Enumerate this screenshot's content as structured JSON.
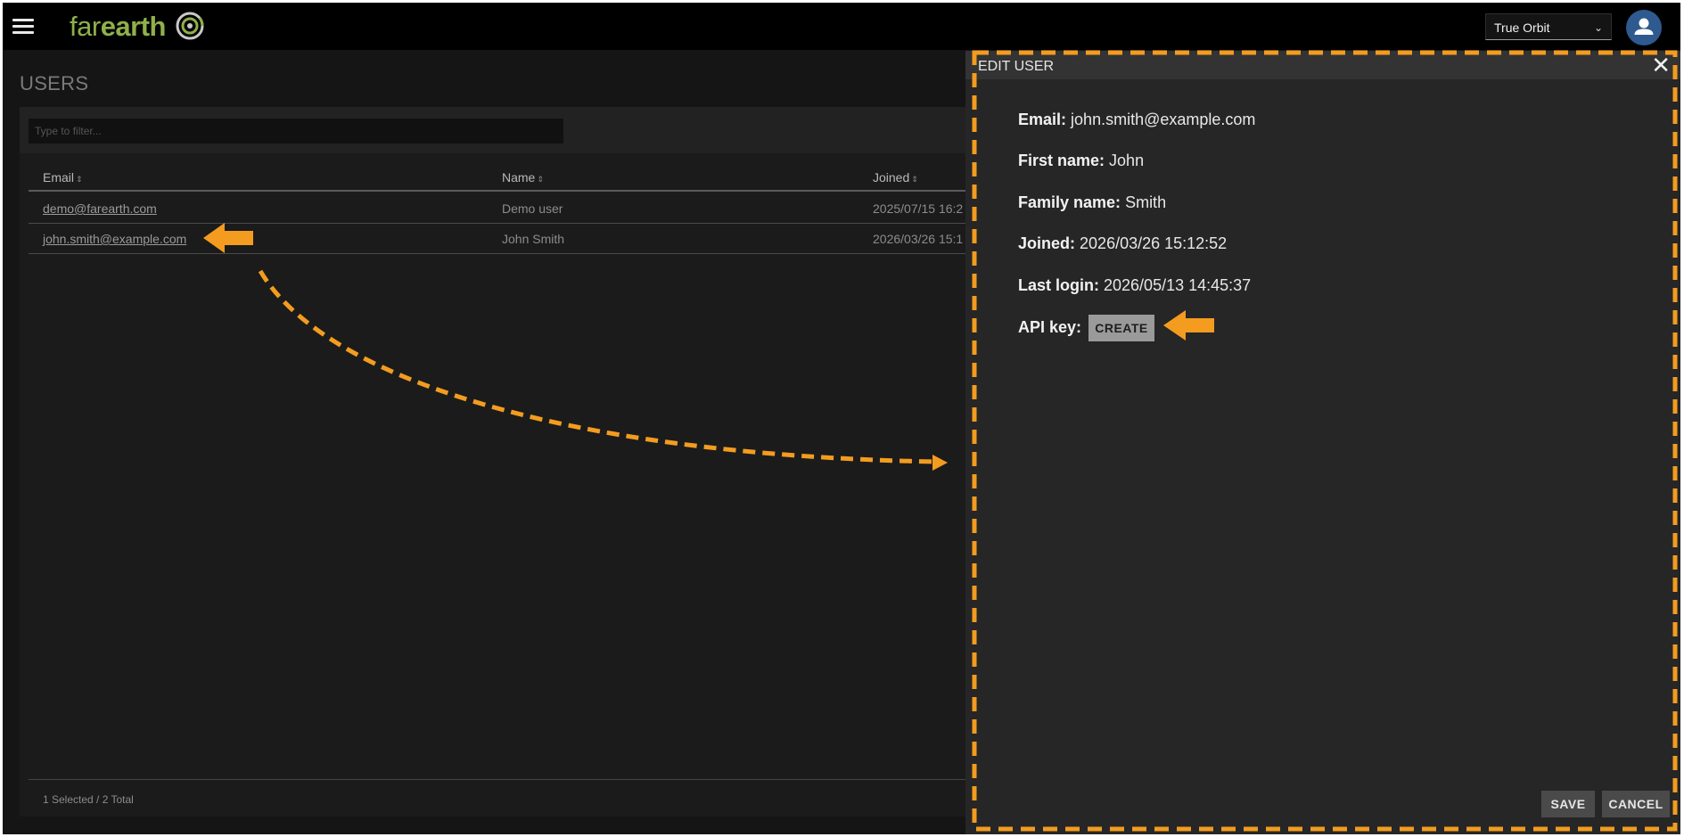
{
  "app": {
    "logo_far": "far",
    "logo_earth": "earth",
    "org_selected": "True Orbit"
  },
  "users_page": {
    "title": "USERS",
    "filter_placeholder": "Type to filter...",
    "columns": [
      "Email",
      "Name",
      "Joined"
    ],
    "rows": [
      {
        "email": "demo@farearth.com",
        "name": "Demo user",
        "joined": "2025/07/15 16:2"
      },
      {
        "email": "john.smith@example.com",
        "name": "John Smith",
        "joined": "2026/03/26 15:1"
      }
    ],
    "footer": "1 Selected / 2 Total"
  },
  "dialog": {
    "title": "EDIT USER",
    "close_glyph": "✕",
    "email_label": "Email:",
    "email_value": "john.smith@example.com",
    "first_name_label": "First name:",
    "first_name_value": "John",
    "family_name_label": "Family name:",
    "family_name_value": "Smith",
    "joined_label": "Joined:",
    "joined_value": "2026/03/26 15:12:52",
    "last_login_label": "Last login:",
    "last_login_value": "2026/05/13 14:45:37",
    "api_key_label": "API key:",
    "create_label": "CREATE",
    "save_label": "SAVE",
    "cancel_label": "CANCEL"
  },
  "icons": {
    "menu": "hamburger-icon",
    "logo_mark": "orbit-swirl-icon",
    "close": "close-icon",
    "avatar": "user-icon",
    "sort": "sort-icon",
    "dropdown": "chevron-down-icon",
    "annotation_arrow": "arrow-left-icon"
  },
  "colors": {
    "brand_green": "#8fb04a",
    "annotation_orange": "#f39c1f",
    "avatar_blue": "#2e5a8f"
  }
}
